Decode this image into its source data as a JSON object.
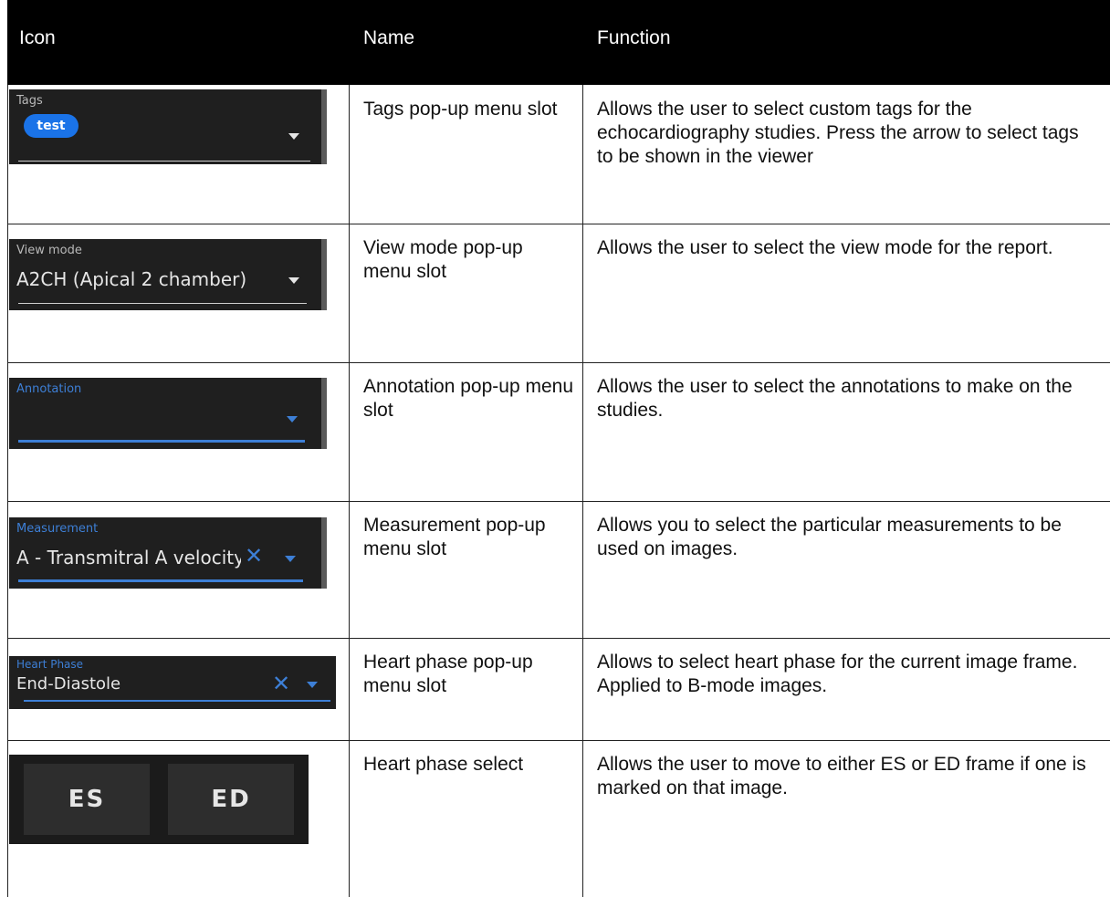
{
  "columns": {
    "icon": "Icon",
    "name": "Name",
    "function": "Function"
  },
  "rows": [
    {
      "widget": {
        "label": "Tags",
        "chip": "test"
      },
      "name": "Tags pop-up menu slot",
      "function": "Allows the user to select custom tags for the echocardiography studies. Press the arrow to select tags to be shown in the viewer"
    },
    {
      "widget": {
        "label": "View mode",
        "value": "A2CH (Apical 2 chamber)"
      },
      "name": "View mode pop-up menu slot",
      "function": "Allows the user to select the view mode for the report."
    },
    {
      "widget": {
        "label": "Annotation"
      },
      "name": "Annotation pop-up menu slot",
      "function": "Allows the user to select the annotations to make on the studies."
    },
    {
      "widget": {
        "label": "Measurement",
        "value": "A - Transmitral A velocity"
      },
      "name": "Measurement pop-up menu slot",
      "function": "Allows you to select the particular measurements to be used on images."
    },
    {
      "widget": {
        "label": "Heart Phase",
        "value": "End-Diastole"
      },
      "name": "Heart phase pop-up menu slot",
      "function": "Allows to select heart phase for the current image frame. Applied to B-mode images."
    },
    {
      "widget": {
        "buttons": [
          "ES",
          "ED"
        ]
      },
      "name": "Heart phase select",
      "function": "Allows the user to move to either ES or ED frame if one is marked on that image."
    }
  ],
  "icons": {
    "dropdown": "chevron-down-icon",
    "clear": "close-icon"
  },
  "colors": {
    "header_bg": "#000000",
    "widget_bg": "#1f1f1f",
    "accent_blue": "#3d7fd6",
    "chip_blue": "#1a73e8"
  }
}
